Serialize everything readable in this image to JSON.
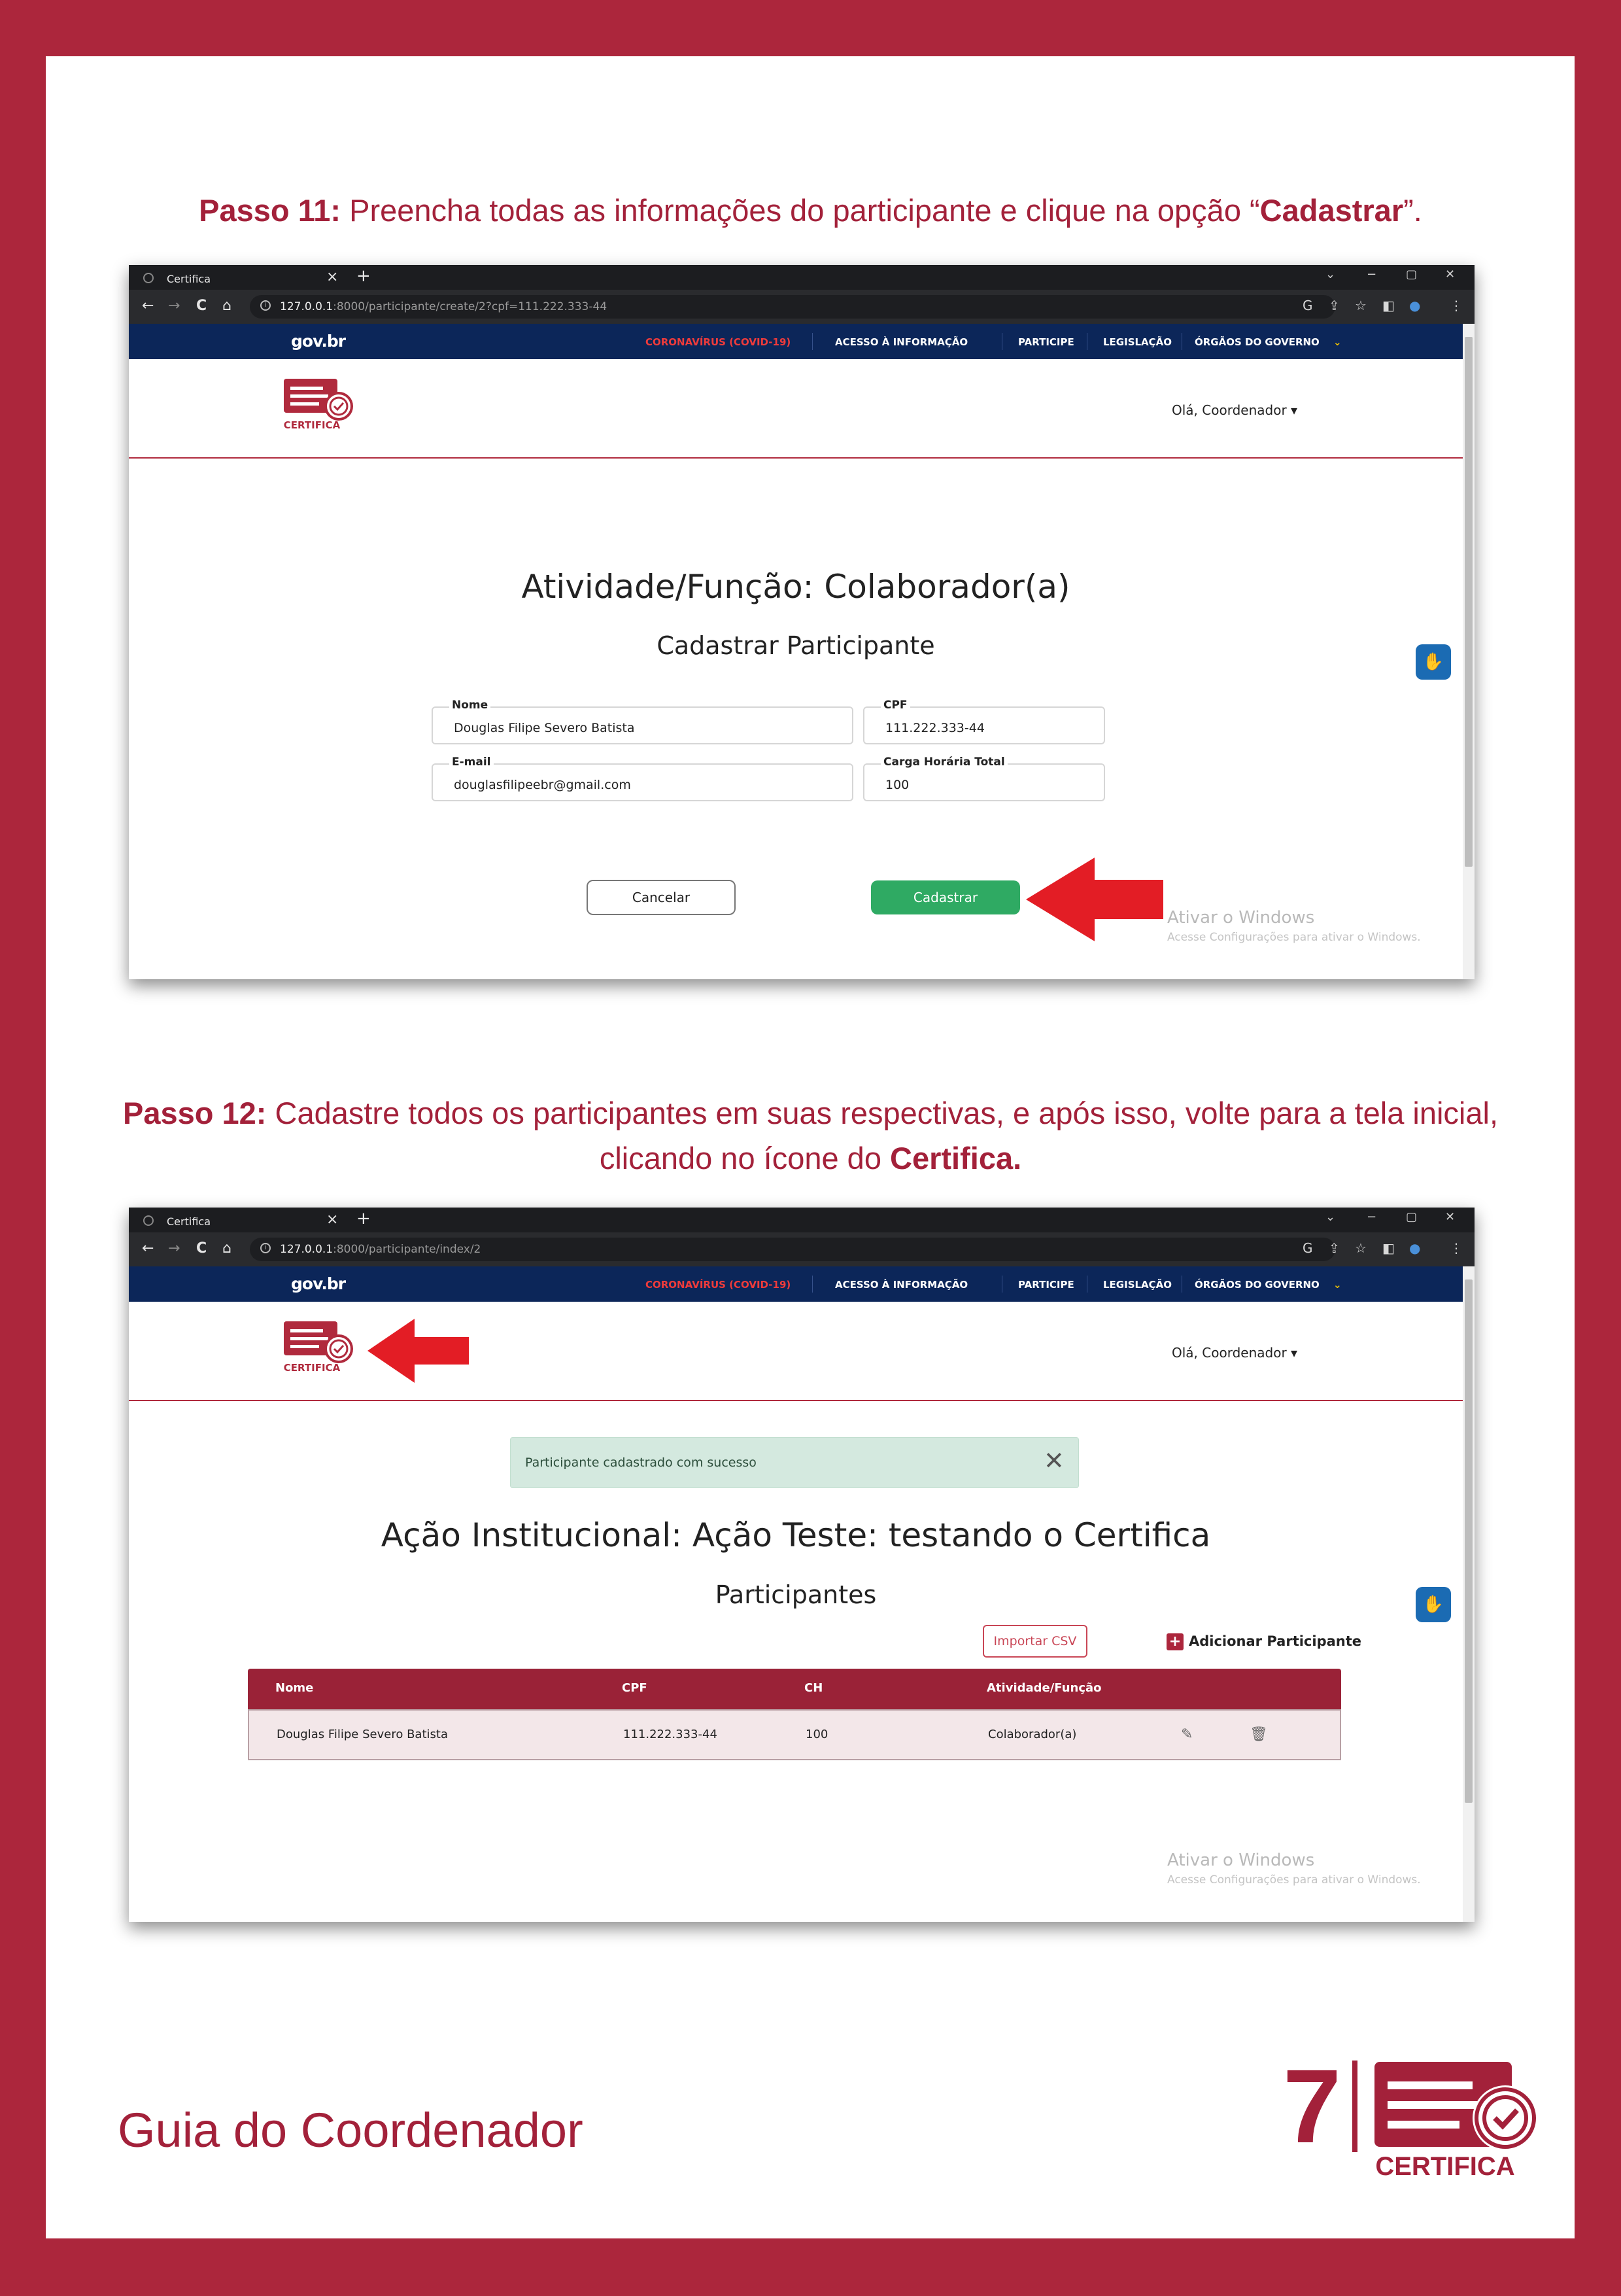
{
  "step11": {
    "label": "Passo 11:",
    "text_a": " Preencha todas as informações do participante e clique na opção “",
    "emph": "Cadastrar",
    "text_b": "”."
  },
  "step12": {
    "label": "Passo 12:",
    "text_a": " Cadastre todos os participantes em suas respectivas, e após isso, volte para a tela inicial,",
    "text_b": "clicando no ícone do ",
    "emph": "Certifica."
  },
  "browser": {
    "tab_title": "Certifica",
    "tab_close": "×",
    "new_tab": "+",
    "win_controls": [
      "⌄",
      "−",
      "▢",
      "✕"
    ],
    "nav": [
      "←",
      "→",
      "C",
      "⌂"
    ],
    "ext_icons": [
      "G",
      "⇪",
      "☆",
      "◧",
      "●",
      "⋮"
    ]
  },
  "shot1": {
    "url_host": "127.0.0.1",
    "url_path": ":8000/participante/create/2?cpf=111.222.333-44"
  },
  "shot2": {
    "url_host": "127.0.0.1",
    "url_path": ":8000/participante/index/2"
  },
  "gov": {
    "logo": "gov.br",
    "items": [
      "CORONAVÍRUS (COVID-19)",
      "ACESSO À INFORMAÇÃO",
      "PARTICIPE",
      "LEGISLAÇÃO",
      "ÓRGÃOS DO GOVERNO"
    ]
  },
  "site": {
    "logo_text": "CERTIFICA",
    "user_menu": "Olá, Coordenador ▾"
  },
  "form": {
    "title": "Atividade/Função: Colaborador(a)",
    "subtitle": "Cadastrar Participante",
    "nome_label": "Nome",
    "nome_value": "Douglas Filipe Severo Batista",
    "cpf_label": "CPF",
    "cpf_value": "111.222.333-44",
    "email_label": "E-mail",
    "email_value": "douglasfilipeebr@gmail.com",
    "ch_label": "Carga Horária Total",
    "ch_value": "100",
    "cancel": "Cancelar",
    "submit": "Cadastrar"
  },
  "watermark": {
    "title": "Ativar o Windows",
    "subtitle": "Acesse Configurações para ativar o Windows."
  },
  "list": {
    "alert": "Participante cadastrado com sucesso",
    "alert_close": "✕",
    "title": "Ação Institucional: Ação Teste: testando o Certifica",
    "subtitle": "Participantes",
    "import_csv": "Importar CSV",
    "add_participant": "Adicionar Participante",
    "headers": [
      "Nome",
      "CPF",
      "CH",
      "Atividade/Função"
    ],
    "row": {
      "nome": "Douglas Filipe Severo Batista",
      "cpf": "111.222.333-44",
      "ch": "100",
      "funcao": "Colaborador(a)"
    },
    "edit_icon": "✎",
    "delete_icon": "🗑"
  },
  "footer": {
    "title": "Guia do Coordenador",
    "page": "7",
    "logo_text": "CERTIFICA"
  },
  "colors": {
    "brand": "#ac263c",
    "gov_bar": "#0c2659",
    "success": "#2faa63",
    "arrow": "#e31d25"
  }
}
